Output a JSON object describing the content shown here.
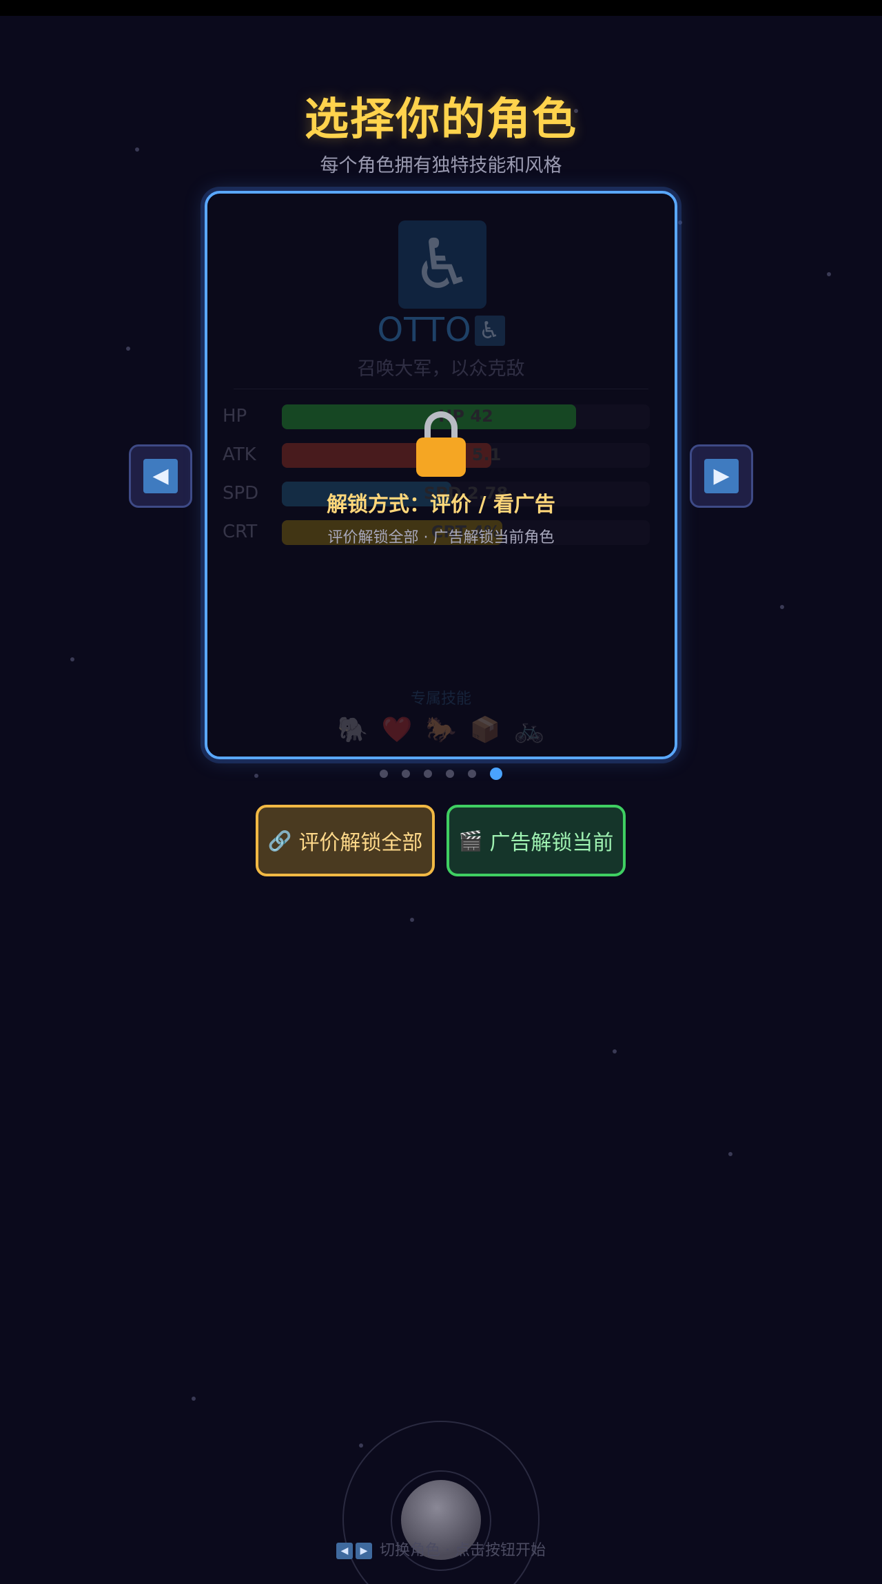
{
  "header": {
    "title": "选择你的角色",
    "subtitle": "每个角色拥有独特技能和风格"
  },
  "character": {
    "avatar_icon": "wheelchair-icon",
    "avatar_glyph": "♿",
    "name": "OTTO",
    "name_badge_glyph": "♿",
    "description": "召唤大军，以众克敌",
    "stats": [
      {
        "label": "HP",
        "value_text": "HP 42",
        "fill_fraction": 0.8,
        "color": "#1f7a2c"
      },
      {
        "label": "ATK",
        "value_text": "ATK 5.1",
        "fill_fraction": 0.57,
        "color": "#7a2a22"
      },
      {
        "label": "SPD",
        "value_text": "SPD 2.78",
        "fill_fraction": 0.46,
        "color": "#1d4a68"
      },
      {
        "label": "CRT",
        "value_text": "CRT 4%",
        "fill_fraction": 0.6,
        "color": "#6e5a12"
      }
    ],
    "skills_title": "专属技能",
    "skills": [
      {
        "icon": "elephant-icon",
        "glyph": "🐘"
      },
      {
        "icon": "heart-icon",
        "glyph": "❤️"
      },
      {
        "icon": "horse-icon",
        "glyph": "🐎"
      },
      {
        "icon": "box-icon",
        "glyph": "📦"
      },
      {
        "icon": "bicycle-icon",
        "glyph": "🚲"
      }
    ]
  },
  "lock": {
    "icon": "lock-icon",
    "title": "解锁方式：评价 / 看广告",
    "subtitle": "评价解锁全部 · 广告解锁当前角色"
  },
  "navigation": {
    "prev_glyph": "◀",
    "next_glyph": "▶",
    "page_count": 6,
    "active_page": 6
  },
  "buttons": {
    "review": {
      "icon": "link-icon",
      "glyph": "🔗",
      "label": "评价解锁全部"
    },
    "ad": {
      "icon": "clapper-icon",
      "glyph": "🎬",
      "label": "广告解锁当前"
    }
  },
  "footer": {
    "hint_text": "切换角色 · 点击按钮开始",
    "key_left": "◀",
    "key_right": "▶"
  },
  "colors": {
    "background": "#0b0a1c",
    "title": "#ffd34d",
    "card_border": "#5aa8ff",
    "review_border": "#f2b944",
    "ad_border": "#3fcf62"
  }
}
